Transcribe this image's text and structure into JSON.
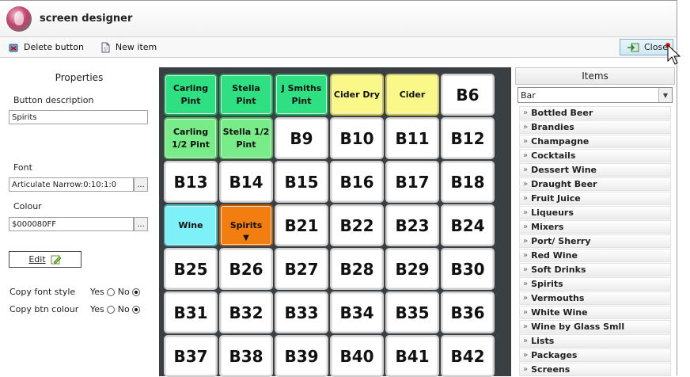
{
  "app": {
    "title": "screen designer"
  },
  "toolbar": {
    "delete_label": "Delete button",
    "new_label": "New item",
    "close_label": "Close"
  },
  "properties": {
    "heading": "Properties",
    "desc_label": "Button description",
    "desc_value": "Spirits",
    "font_label": "Font",
    "font_value": "Articulate Narrow:0:10:1:0",
    "colour_label": "Colour",
    "colour_value": "$000080FF",
    "dots": "...",
    "edit_label": "Edit",
    "copy_font_label": "Copy font style",
    "copy_colour_label": "Copy btn colour",
    "yes": "Yes",
    "no": "No"
  },
  "grid": {
    "buttons": [
      {
        "label": "Carling Pint",
        "color": "green",
        "small": true
      },
      {
        "label": "Stella Pint",
        "color": "green",
        "small": true
      },
      {
        "label": "J Smiths Pint",
        "color": "green",
        "small": true
      },
      {
        "label": "Cider Dry",
        "color": "yellow",
        "small": true
      },
      {
        "label": "Cider",
        "color": "yellow",
        "small": true
      },
      {
        "label": "B6"
      },
      {
        "label": "Carling 1/2 Pint",
        "color": "lgreen",
        "small": true
      },
      {
        "label": "Stella 1/2 Pint",
        "color": "lgreen",
        "small": true
      },
      {
        "label": "B9"
      },
      {
        "label": "B10"
      },
      {
        "label": "B11"
      },
      {
        "label": "B12"
      },
      {
        "label": "B13"
      },
      {
        "label": "B14"
      },
      {
        "label": "B15"
      },
      {
        "label": "B16"
      },
      {
        "label": "B17"
      },
      {
        "label": "B18"
      },
      {
        "label": "Wine",
        "color": "cyan",
        "small": true
      },
      {
        "label": "Spirits",
        "color": "orange",
        "small": true,
        "arrow": "▼"
      },
      {
        "label": "B21"
      },
      {
        "label": "B22"
      },
      {
        "label": "B23"
      },
      {
        "label": "B24"
      },
      {
        "label": "B25"
      },
      {
        "label": "B26"
      },
      {
        "label": "B27"
      },
      {
        "label": "B28"
      },
      {
        "label": "B29"
      },
      {
        "label": "B30"
      },
      {
        "label": "B31"
      },
      {
        "label": "B32"
      },
      {
        "label": "B33"
      },
      {
        "label": "B34"
      },
      {
        "label": "B35"
      },
      {
        "label": "B36"
      },
      {
        "label": "B37"
      },
      {
        "label": "B38"
      },
      {
        "label": "B39"
      },
      {
        "label": "B40"
      },
      {
        "label": "B41"
      },
      {
        "label": "B42"
      }
    ]
  },
  "items": {
    "heading": "Items",
    "selected": "Bar",
    "categories": [
      "Bottled Beer",
      "Brandies",
      "Champagne",
      "Cocktails",
      "Dessert Wine",
      "Draught Beer",
      "Fruit Juice",
      "Liqueurs",
      "Mixers",
      "Port/ Sherry",
      "Red Wine",
      "Soft Drinks",
      "Spirits",
      "Vermouths",
      "White Wine",
      "Wine by Glass Smll",
      "Lists",
      "Packages",
      "Screens"
    ]
  }
}
